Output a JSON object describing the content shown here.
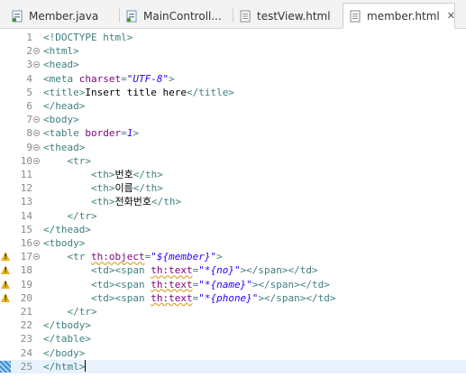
{
  "tabs": [
    {
      "label": "Member.java",
      "icon": "java-file-icon",
      "active": false
    },
    {
      "label": "MainControll...",
      "icon": "java-file-icon",
      "active": false
    },
    {
      "label": "testView.html",
      "icon": "html-file-icon",
      "active": false
    },
    {
      "label": "member.html",
      "icon": "html-file-icon",
      "active": true,
      "close": "✕"
    }
  ],
  "editor": {
    "line_numbers": [
      "1",
      "2",
      "3",
      "4",
      "5",
      "6",
      "7",
      "8",
      "9",
      "10",
      "11",
      "12",
      "13",
      "14",
      "15",
      "16",
      "17",
      "18",
      "19",
      "20",
      "21",
      "22",
      "23",
      "24",
      "25"
    ],
    "lines": [
      {
        "n": "1",
        "fold": false,
        "marker": "",
        "segments": [
          [
            "tag",
            "<!DOCTYPE html>"
          ]
        ]
      },
      {
        "n": "2",
        "fold": true,
        "marker": "",
        "segments": [
          [
            "tag",
            "<html>"
          ]
        ]
      },
      {
        "n": "3",
        "fold": true,
        "marker": "",
        "segments": [
          [
            "tag",
            "<head>"
          ]
        ]
      },
      {
        "n": "4",
        "fold": false,
        "marker": "",
        "segments": [
          [
            "tag",
            "<meta "
          ],
          [
            "attr",
            "charset"
          ],
          [
            "tag",
            "="
          ],
          [
            "val",
            "\"UTF-8\""
          ],
          [
            "tag",
            ">"
          ]
        ]
      },
      {
        "n": "5",
        "fold": false,
        "marker": "",
        "segments": [
          [
            "tag",
            "<title>"
          ],
          [
            "txt",
            "Insert title here"
          ],
          [
            "tag",
            "</title>"
          ]
        ]
      },
      {
        "n": "6",
        "fold": false,
        "marker": "",
        "segments": [
          [
            "tag",
            "</head>"
          ]
        ]
      },
      {
        "n": "7",
        "fold": true,
        "marker": "",
        "segments": [
          [
            "tag",
            "<body>"
          ]
        ]
      },
      {
        "n": "8",
        "fold": true,
        "marker": "",
        "segments": [
          [
            "tag",
            "<table "
          ],
          [
            "attr",
            "border"
          ],
          [
            "tag",
            "="
          ],
          [
            "val",
            "1"
          ],
          [
            "tag",
            ">"
          ]
        ]
      },
      {
        "n": "9",
        "fold": true,
        "marker": "",
        "segments": [
          [
            "tag",
            "<thead>"
          ]
        ]
      },
      {
        "n": "10",
        "fold": true,
        "marker": "",
        "segments": [
          [
            "txt",
            "    "
          ],
          [
            "tag",
            "<tr>"
          ]
        ]
      },
      {
        "n": "11",
        "fold": false,
        "marker": "",
        "segments": [
          [
            "txt",
            "        "
          ],
          [
            "tag",
            "<th>"
          ],
          [
            "txt",
            "번호"
          ],
          [
            "tag",
            "</th>"
          ]
        ]
      },
      {
        "n": "12",
        "fold": false,
        "marker": "",
        "segments": [
          [
            "txt",
            "        "
          ],
          [
            "tag",
            "<th>"
          ],
          [
            "txt",
            "이름"
          ],
          [
            "tag",
            "</th>"
          ]
        ]
      },
      {
        "n": "13",
        "fold": false,
        "marker": "",
        "segments": [
          [
            "txt",
            "        "
          ],
          [
            "tag",
            "<th>"
          ],
          [
            "txt",
            "전화번호"
          ],
          [
            "tag",
            "</th>"
          ]
        ]
      },
      {
        "n": "14",
        "fold": false,
        "marker": "",
        "segments": [
          [
            "txt",
            "    "
          ],
          [
            "tag",
            "</tr>"
          ]
        ]
      },
      {
        "n": "15",
        "fold": false,
        "marker": "",
        "segments": [
          [
            "tag",
            "</thead>"
          ]
        ]
      },
      {
        "n": "16",
        "fold": true,
        "marker": "",
        "segments": [
          [
            "tag",
            "<tbody>"
          ]
        ]
      },
      {
        "n": "17",
        "fold": true,
        "marker": "warning",
        "segments": [
          [
            "txt",
            "    "
          ],
          [
            "tag",
            "<tr "
          ],
          [
            "sqattr",
            "th:object"
          ],
          [
            "tag",
            "="
          ],
          [
            "val",
            "\"${member}\""
          ],
          [
            "tag",
            ">"
          ]
        ]
      },
      {
        "n": "18",
        "fold": false,
        "marker": "warning",
        "segments": [
          [
            "txt",
            "        "
          ],
          [
            "tag",
            "<td><span "
          ],
          [
            "sqattr",
            "th:text"
          ],
          [
            "tag",
            "="
          ],
          [
            "val",
            "\"*{no}\""
          ],
          [
            "tag",
            "></span></td>"
          ]
        ]
      },
      {
        "n": "19",
        "fold": false,
        "marker": "warning",
        "segments": [
          [
            "txt",
            "        "
          ],
          [
            "tag",
            "<td><span "
          ],
          [
            "sqattr",
            "th:text"
          ],
          [
            "tag",
            "="
          ],
          [
            "val",
            "\"*{name}\""
          ],
          [
            "tag",
            "></span></td>"
          ]
        ]
      },
      {
        "n": "20",
        "fold": false,
        "marker": "warning",
        "segments": [
          [
            "txt",
            "        "
          ],
          [
            "tag",
            "<td><span "
          ],
          [
            "sqattr",
            "th:text"
          ],
          [
            "tag",
            "="
          ],
          [
            "val",
            "\"*{phone}\""
          ],
          [
            "tag",
            "></span></td>"
          ]
        ]
      },
      {
        "n": "21",
        "fold": false,
        "marker": "",
        "segments": [
          [
            "txt",
            "    "
          ],
          [
            "tag",
            "</tr>"
          ]
        ]
      },
      {
        "n": "22",
        "fold": false,
        "marker": "",
        "segments": [
          [
            "tag",
            "</tbody>"
          ]
        ]
      },
      {
        "n": "23",
        "fold": false,
        "marker": "",
        "segments": [
          [
            "tag",
            "</table>"
          ]
        ]
      },
      {
        "n": "24",
        "fold": false,
        "marker": "",
        "segments": [
          [
            "tag",
            "</body>"
          ]
        ]
      },
      {
        "n": "25",
        "fold": false,
        "marker": "current",
        "segments": [
          [
            "tag",
            "</html>"
          ]
        ]
      }
    ]
  },
  "colors": {
    "tag": "#3f7f7f",
    "attribute": "#7f007f",
    "value": "#2a00ff",
    "warning": "#e8b21a",
    "current_line": "#e8f2fe"
  }
}
